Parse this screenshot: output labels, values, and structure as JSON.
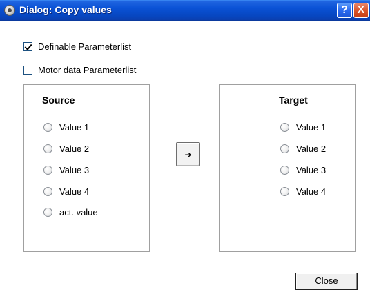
{
  "window": {
    "title": "Dialog: Copy values",
    "help_glyph": "?",
    "close_glyph": "X",
    "title_icon": "app-icon"
  },
  "options": {
    "definable": {
      "label": "Definable Parameterlist",
      "checked": true
    },
    "motor": {
      "label": "Motor data Parameterlist",
      "checked": false
    }
  },
  "source": {
    "title": "Source",
    "items": [
      "Value 1",
      "Value 2",
      "Value 3",
      "Value 4",
      "act. value"
    ]
  },
  "target": {
    "title": "Target",
    "items": [
      "Value 1",
      "Value 2",
      "Value 3",
      "Value 4"
    ]
  },
  "copy_button": {
    "glyph": "➔",
    "icon": "arrow-right-icon"
  },
  "close_button": {
    "label": "Close"
  }
}
